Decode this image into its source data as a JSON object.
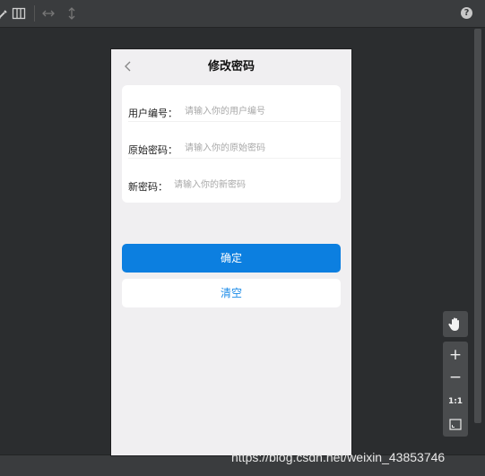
{
  "toolbar": {
    "icons": [
      "eyedropper-icon",
      "columns-icon",
      "horizontal-resize-icon",
      "vertical-resize-icon",
      "help-icon"
    ],
    "help_label": "?"
  },
  "phone": {
    "nav": {
      "title": "修改密码",
      "back_icon": "chevron-left-icon"
    },
    "form": {
      "fields": [
        {
          "label": "用户编号：",
          "placeholder": "请输入你的用户编号"
        },
        {
          "label": "原始密码：",
          "placeholder": "请输入你的原始密码"
        },
        {
          "label": "新密码：",
          "placeholder": "请输入你的新密码"
        }
      ]
    },
    "confirm_label": "确定",
    "clear_label": "清空",
    "colors": {
      "primary": "#0c7fe0",
      "link": "#1d8ce8",
      "background": "#f0eff1"
    }
  },
  "tools": {
    "hand_icon": "hand-icon",
    "zoom_in_label": "+",
    "zoom_out_label": "−",
    "actual_size_label": "1:1",
    "fit_icon": "fit-screen-icon"
  },
  "watermark": "https://blog.csdn.net/weixin_43853746"
}
